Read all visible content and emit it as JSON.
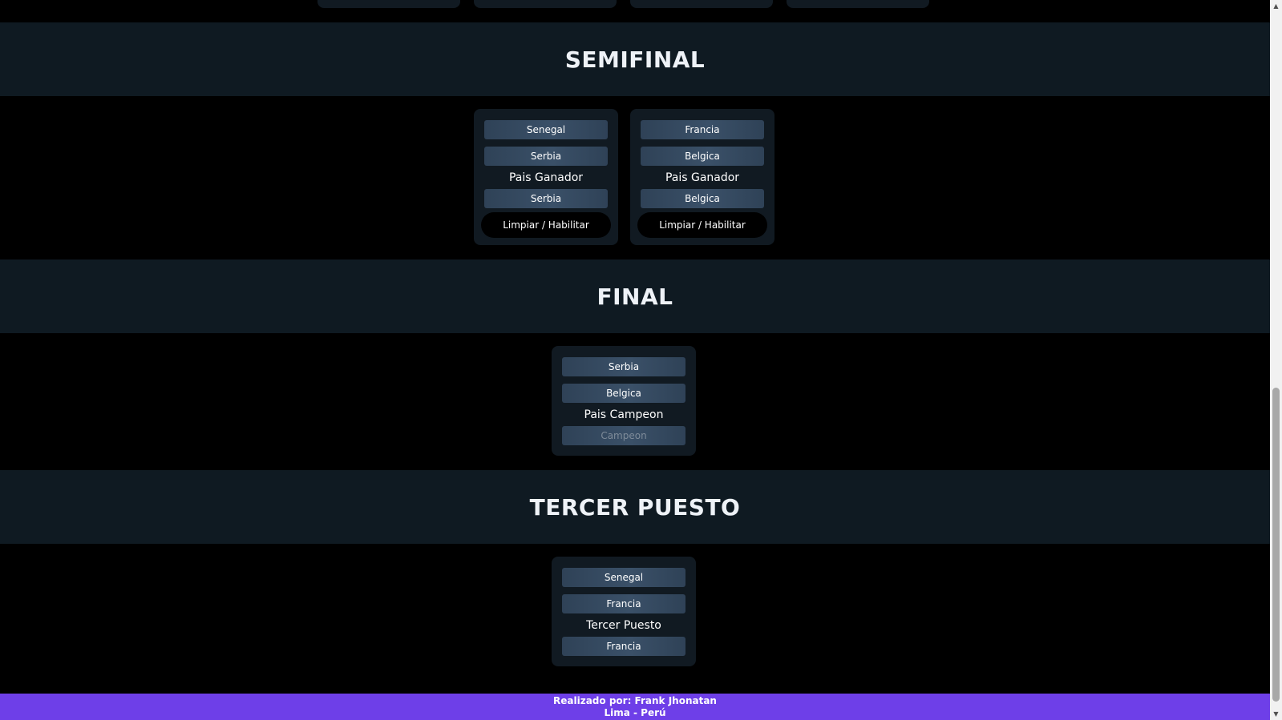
{
  "sections": {
    "semifinal": {
      "title": "SEMIFINAL",
      "matches": [
        {
          "team_a": "Senegal",
          "team_b": "Serbia",
          "result_label": "Pais Ganador",
          "winner": "Serbia",
          "reset_label": "Limpiar / Habilitar"
        },
        {
          "team_a": "Francia",
          "team_b": "Belgica",
          "result_label": "Pais Ganador",
          "winner": "Belgica",
          "reset_label": "Limpiar / Habilitar"
        }
      ]
    },
    "final": {
      "title": "FINAL",
      "match": {
        "team_a": "Serbia",
        "team_b": "Belgica",
        "result_label": "Pais Campeon",
        "winner_placeholder": "Campeon"
      }
    },
    "tercer_puesto": {
      "title": "TERCER PUESTO",
      "match": {
        "team_a": "Senegal",
        "team_b": "Francia",
        "result_label": "Tercer Puesto",
        "winner": "Francia"
      }
    }
  },
  "footer": {
    "line1": "Realizado por: Frank Jhonatan",
    "line2": "Lima - Perú"
  },
  "colors": {
    "background": "#000000",
    "band": "#0f1a22",
    "card": "#111a22",
    "button": "#34495e",
    "footer": "#6e3fe8"
  },
  "icons": {
    "scroll_up": "triangle-up-icon",
    "scroll_down": "triangle-down-icon"
  }
}
